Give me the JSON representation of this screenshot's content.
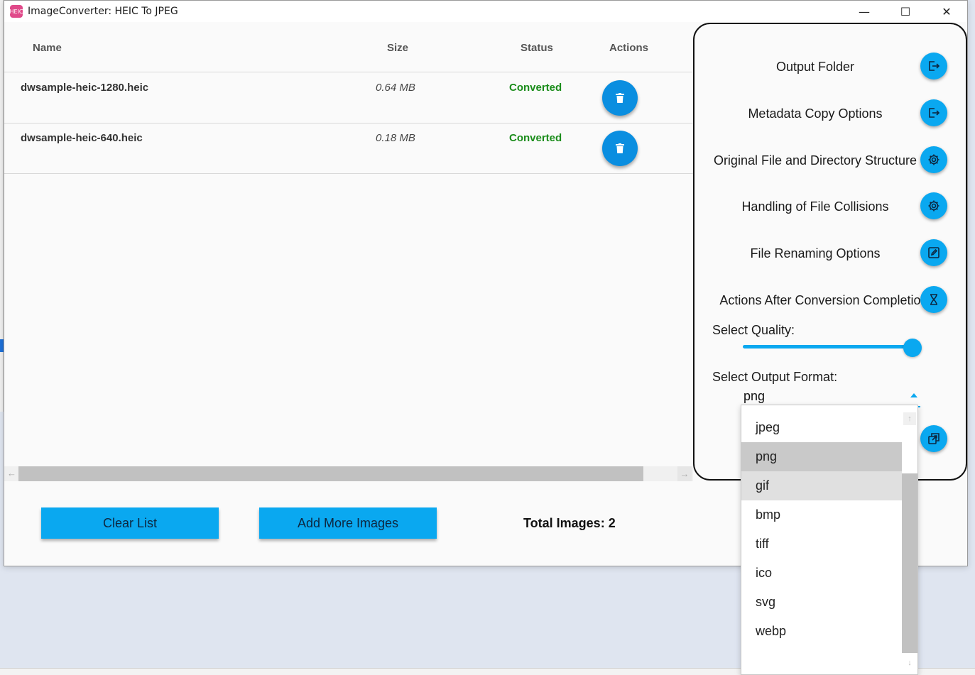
{
  "window": {
    "title": "ImageConverter: HEIC To JPEG",
    "app_icon_text": "HEIC",
    "controls": {
      "minimize": "—",
      "maximize": "☐",
      "close": "✕"
    }
  },
  "table": {
    "headers": {
      "name": "Name",
      "size": "Size",
      "status": "Status",
      "actions": "Actions"
    },
    "rows": [
      {
        "name": "dwsample-heic-1280.heic",
        "size": "0.64 MB",
        "status": "Converted"
      },
      {
        "name": "dwsample-heic-640.heic",
        "size": "0.18 MB",
        "status": "Converted"
      }
    ]
  },
  "footer": {
    "clear_label": "Clear List",
    "add_label": "Add More Images",
    "total_label": "Total Images: 2"
  },
  "panel": {
    "options": [
      {
        "label": "Output Folder",
        "icon": "logout-icon"
      },
      {
        "label": "Metadata Copy Options",
        "icon": "logout-icon"
      },
      {
        "label": "Original File and Directory Structure",
        "icon": "gear-icon"
      },
      {
        "label": "Handling of File Collisions",
        "icon": "gear-icon"
      },
      {
        "label": "File Renaming Options",
        "icon": "edit-icon"
      },
      {
        "label": "Actions After Conversion Completion",
        "icon": "hourglass-icon"
      }
    ],
    "quality_label": "Select Quality:",
    "quality_value": 1.0,
    "format_label": "Select Output Format:",
    "format_selected": "png",
    "format_options": [
      "jpeg",
      "png",
      "gif",
      "bmp",
      "tiff",
      "ico",
      "svg",
      "webp"
    ]
  },
  "colors": {
    "accent": "#0aa8f0",
    "delete_button": "#0a8ee0",
    "status_converted": "#1a8c1a"
  }
}
